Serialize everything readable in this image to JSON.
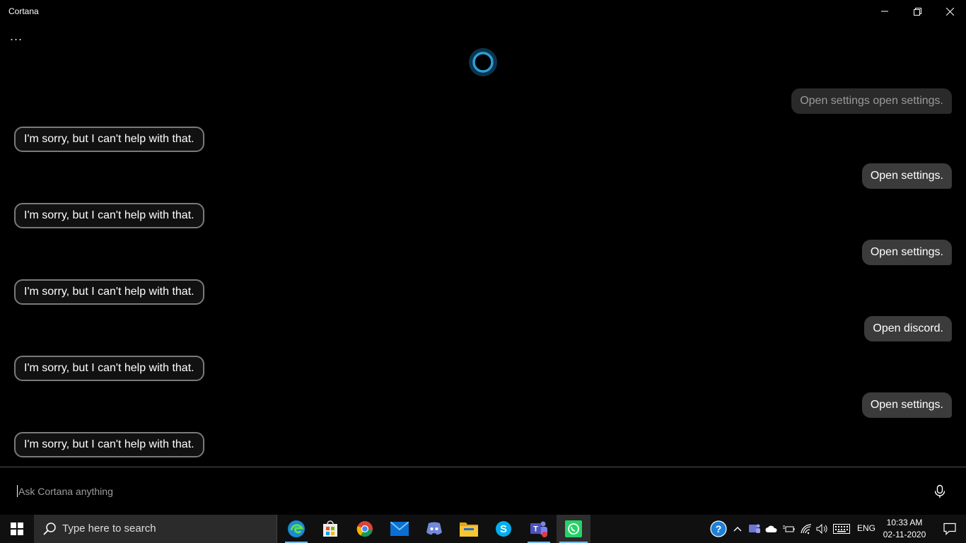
{
  "window": {
    "title": "Cortana"
  },
  "menu": {
    "more_label": "..."
  },
  "conversation": [
    {
      "side": "user",
      "text": "Open settings open settings.",
      "faded": true
    },
    {
      "side": "cortana",
      "text": "I'm sorry, but I can't help with that."
    },
    {
      "side": "user",
      "text": "Open settings."
    },
    {
      "side": "cortana",
      "text": "I'm sorry, but I can't help with that."
    },
    {
      "side": "user",
      "text": "Open settings."
    },
    {
      "side": "cortana",
      "text": "I'm sorry, but I can't help with that."
    },
    {
      "side": "user",
      "text": "Open discord."
    },
    {
      "side": "cortana",
      "text": "I'm sorry, but I can't help with that."
    },
    {
      "side": "user",
      "text": "Open settings."
    },
    {
      "side": "cortana",
      "text": "I'm sorry, but I can't help with that."
    }
  ],
  "ask": {
    "placeholder": "Ask Cortana anything",
    "value": ""
  },
  "taskbar": {
    "search_placeholder": "Type here to search",
    "apps": [
      "edge-icon",
      "store-icon",
      "chrome-icon",
      "mail-icon",
      "discord-icon",
      "file-explorer-icon",
      "skype-icon",
      "teams-icon",
      "whatsapp-icon"
    ],
    "language": "ENG",
    "time": "10:33 AM",
    "date": "02-11-2020"
  },
  "colors": {
    "cortana_ring": "#2b9fd9",
    "accent_underline": "#76b9ed",
    "bubble_user": "#3b3b3b"
  }
}
